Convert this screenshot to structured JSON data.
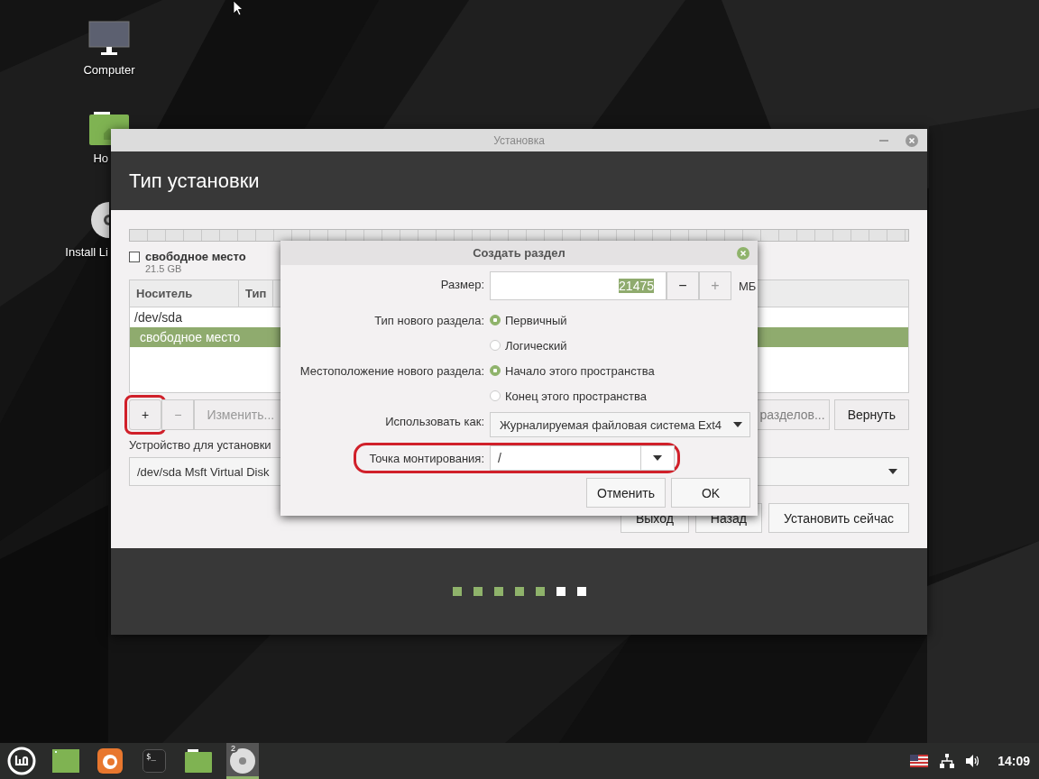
{
  "desktop_icons": [
    {
      "kind": "computer",
      "label": "Computer"
    },
    {
      "kind": "folder",
      "label": "Ho"
    },
    {
      "kind": "disc",
      "label": "Install Li"
    }
  ],
  "installer": {
    "title": "Установка",
    "heading": "Тип установки",
    "free_space": {
      "label": "свободное место",
      "size": "21.5 GB",
      "checked": false
    },
    "table": {
      "columns": [
        "Носитель",
        "Тип"
      ],
      "rows": [
        {
          "device": "/dev/sda",
          "selected": false,
          "children": [
            {
              "device": "свободное место",
              "selected": true
            }
          ]
        }
      ]
    },
    "partition_buttons": [
      {
        "label": "+",
        "disabled": false,
        "circled": true
      },
      {
        "label": "−",
        "disabled": true,
        "circled": false
      },
      {
        "label": "Изменить...",
        "disabled": true,
        "circled": false
      }
    ],
    "right_buttons": [
      {
        "label": "разделов...",
        "disabled": true
      },
      {
        "label": "Вернуть",
        "disabled": false
      }
    ],
    "device_label": "Устройство для установки",
    "device_value": "/dev/sda Msft Virtual Disk",
    "nav_buttons": [
      "Выход",
      "Назад",
      "Установить сейчас"
    ],
    "steps": [
      {
        "done": true
      },
      {
        "done": true
      },
      {
        "done": true
      },
      {
        "done": true
      },
      {
        "done": true
      },
      {
        "done": false
      },
      {
        "done": false
      }
    ]
  },
  "dialog": {
    "title": "Создать раздел",
    "size": {
      "label": "Размер:",
      "value": "21475",
      "unit": "МБ",
      "minus": "−",
      "plus": "+"
    },
    "type_label": "Тип нового раздела:",
    "type_options": [
      {
        "label": "Первичный",
        "selected": true
      },
      {
        "label": "Логический",
        "selected": false
      }
    ],
    "location_label": "Местоположение нового раздела:",
    "location_options": [
      {
        "label": "Начало этого пространства",
        "selected": true
      },
      {
        "label": "Конец этого пространства",
        "selected": false
      }
    ],
    "use_as_label": "Использовать как:",
    "use_as_value": "Журналируемая файловая система Ext4",
    "mount_label": "Точка монтирования:",
    "mount_value": "/",
    "mount_circled": true,
    "buttons": [
      "Отменить",
      "OK"
    ]
  },
  "taskbar": {
    "apps": [
      {
        "kind": "menu",
        "active": false
      },
      {
        "kind": "window",
        "active": false
      },
      {
        "kind": "browser",
        "active": false
      },
      {
        "kind": "terminal",
        "label": "$_",
        "active": false
      },
      {
        "kind": "folder",
        "active": false
      },
      {
        "kind": "disc",
        "badge": "2",
        "active": true
      }
    ],
    "clock": "14:09"
  }
}
